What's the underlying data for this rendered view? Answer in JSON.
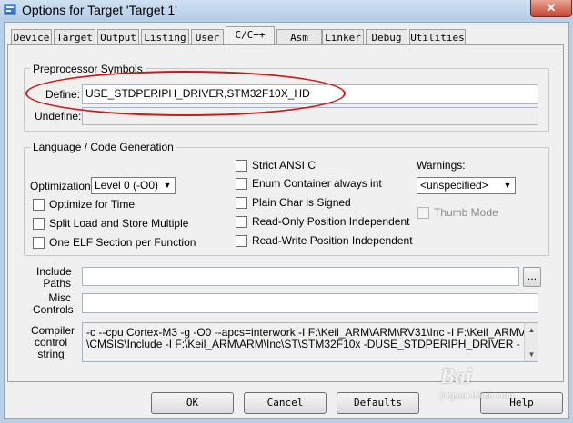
{
  "window": {
    "title": "Options for Target 'Target 1'",
    "close_label": "✕"
  },
  "tabs": [
    {
      "label": "Device"
    },
    {
      "label": "Target"
    },
    {
      "label": "Output"
    },
    {
      "label": "Listing"
    },
    {
      "label": "User"
    },
    {
      "label": "C/C++"
    },
    {
      "label": "Asm"
    },
    {
      "label": "Linker"
    },
    {
      "label": "Debug"
    },
    {
      "label": "Utilities"
    }
  ],
  "preprocessor": {
    "group_label": "Preprocessor Symbols",
    "define_label": "Define:",
    "define_value": "USE_STDPERIPH_DRIVER,STM32F10X_HD",
    "undefine_label": "Undefine:",
    "undefine_value": ""
  },
  "language": {
    "group_label": "Language / Code Generation",
    "optimization_label": "Optimization:",
    "optimization_value": "Level 0 (-O0)",
    "checkboxes_left": [
      {
        "label": "Optimize for Time"
      },
      {
        "label": "Split Load and Store Multiple"
      },
      {
        "label": "One ELF Section per Function"
      }
    ],
    "checkboxes_mid": [
      {
        "label": "Strict ANSI C"
      },
      {
        "label": "Enum Container always int"
      },
      {
        "label": "Plain Char is Signed"
      },
      {
        "label": "Read-Only Position Independent"
      },
      {
        "label": "Read-Write Position Independent"
      }
    ],
    "warnings_label": "Warnings:",
    "warnings_value": "<unspecified>",
    "thumb_mode_label": "Thumb Mode"
  },
  "paths": {
    "include_label": "Include Paths",
    "include_value": "",
    "misc_label": "Misc Controls",
    "misc_value": "",
    "compiler_label": "Compiler control string",
    "compiler_line1": "-c --cpu Cortex-M3 -g -O0 --apcs=interwork -I F:\\Keil_ARM\\ARM\\RV31\\Inc -I F:\\Keil_ARM\\ARM",
    "compiler_line2": "\\CMSIS\\Include -I F:\\Keil_ARM\\ARM\\Inc\\ST\\STM32F10x -DUSE_STDPERIPH_DRIVER -",
    "browse_label": "..."
  },
  "buttons": {
    "ok": "OK",
    "cancel": "Cancel",
    "defaults": "Defaults",
    "help": "Help"
  },
  "watermark": {
    "text": "Bai",
    "text2": "jingyan.baidu.com"
  },
  "colors": {
    "annotation": "#d01818",
    "titlebar": "#b7cde6"
  }
}
